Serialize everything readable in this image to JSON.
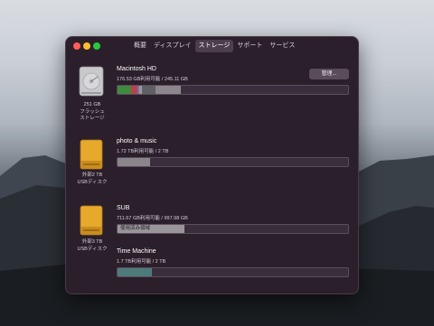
{
  "window": {
    "tabs": [
      {
        "label": "概要",
        "active": false
      },
      {
        "label": "ディスプレイ",
        "active": false
      },
      {
        "label": "ストレージ",
        "active": true
      },
      {
        "label": "サポート",
        "active": false
      },
      {
        "label": "サービス",
        "active": false
      }
    ]
  },
  "drives": {
    "internal": {
      "name": "Macintosh HD",
      "capacity": "176.53 GB利用可能 / 245.11 GB",
      "manage_label": "管理...",
      "label_line1": "251 GB",
      "label_line2": "フラッシュ",
      "label_line3": "ストレージ",
      "usage": [
        {
          "color": "#3f8a3f",
          "fraction": 0.06
        },
        {
          "color": "#b8424d",
          "fraction": 0.025
        },
        {
          "color": "#7a6fb2",
          "fraction": 0.01
        },
        {
          "color": "#9a9a9a",
          "fraction": 0.01
        },
        {
          "color": "#5f5f66",
          "fraction": 0.06
        },
        {
          "color": "#8d878d",
          "fraction": 0.11
        }
      ]
    },
    "external1": {
      "name": "photo & music",
      "capacity": "1.72 TB利用可能 / 2 TB",
      "label_line1": "外部2 TB",
      "label_line2": "USBディスク",
      "usage": [
        {
          "color": "#8a848b",
          "fraction": 0.14
        }
      ]
    },
    "external2": {
      "volumes": [
        {
          "name": "SUB",
          "capacity": "711.67 GB利用可能 / 997.98 GB",
          "bar_text": "使用済み領域",
          "usage": [
            {
              "color": "#9a959b",
              "fraction": 0.29
            }
          ]
        },
        {
          "name": "Time Machine",
          "capacity": "1.7 TB利用可能 / 2 TB",
          "usage": [
            {
              "color": "#4e7a7a",
              "fraction": 0.15
            }
          ]
        }
      ],
      "label_line1": "外部3 TB",
      "label_line2": "USBディスク"
    }
  },
  "colors": {
    "window_bg": "#2a1f2b",
    "drive_gold": "#e7a92c"
  }
}
